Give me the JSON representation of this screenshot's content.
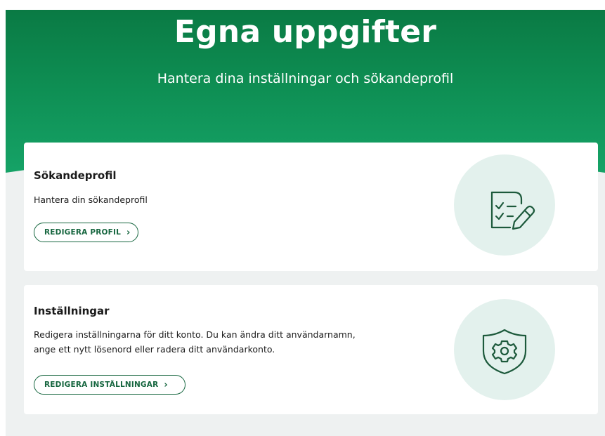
{
  "hero": {
    "title": "Egna uppgifter",
    "subtitle": "Hantera dina inställningar och sökandeprofil"
  },
  "cards": [
    {
      "title": "Sökandeprofil",
      "description": "Hantera din sökandeprofil",
      "button_label": "REDIGERA PROFIL",
      "icon": "checklist-edit-icon"
    },
    {
      "title": "Inställningar",
      "description": "Redigera inställningarna för ditt konto. Du kan ändra ditt användarnamn, ange ett nytt lösenord eller radera ditt användarkonto.",
      "button_label": "REDIGERA INSTÄLLNINGAR",
      "icon": "shield-gear-icon"
    }
  ],
  "colors": {
    "brand_green": "#0e8e53",
    "button_border": "#16663f",
    "page_background": "#eef1f1",
    "illustration_circle": "#e3f1ed"
  }
}
